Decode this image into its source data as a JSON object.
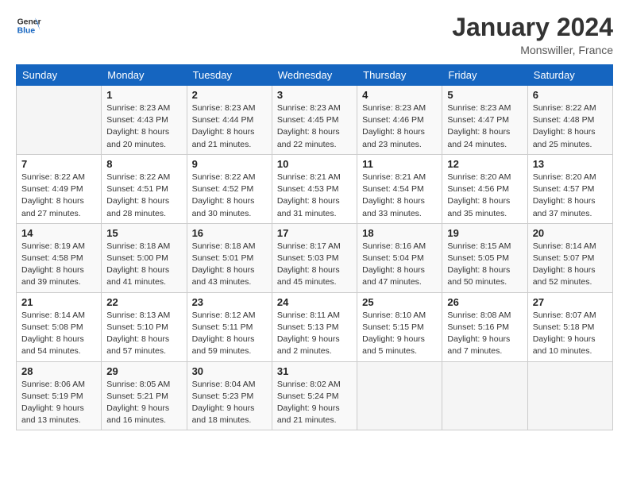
{
  "header": {
    "title": "January 2024",
    "location": "Monswiller, France"
  },
  "columns": [
    "Sunday",
    "Monday",
    "Tuesday",
    "Wednesday",
    "Thursday",
    "Friday",
    "Saturday"
  ],
  "weeks": [
    [
      {
        "day": "",
        "sunrise": "",
        "sunset": "",
        "daylight": ""
      },
      {
        "day": "1",
        "sunrise": "Sunrise: 8:23 AM",
        "sunset": "Sunset: 4:43 PM",
        "daylight": "Daylight: 8 hours and 20 minutes."
      },
      {
        "day": "2",
        "sunrise": "Sunrise: 8:23 AM",
        "sunset": "Sunset: 4:44 PM",
        "daylight": "Daylight: 8 hours and 21 minutes."
      },
      {
        "day": "3",
        "sunrise": "Sunrise: 8:23 AM",
        "sunset": "Sunset: 4:45 PM",
        "daylight": "Daylight: 8 hours and 22 minutes."
      },
      {
        "day": "4",
        "sunrise": "Sunrise: 8:23 AM",
        "sunset": "Sunset: 4:46 PM",
        "daylight": "Daylight: 8 hours and 23 minutes."
      },
      {
        "day": "5",
        "sunrise": "Sunrise: 8:23 AM",
        "sunset": "Sunset: 4:47 PM",
        "daylight": "Daylight: 8 hours and 24 minutes."
      },
      {
        "day": "6",
        "sunrise": "Sunrise: 8:22 AM",
        "sunset": "Sunset: 4:48 PM",
        "daylight": "Daylight: 8 hours and 25 minutes."
      }
    ],
    [
      {
        "day": "7",
        "sunrise": "Sunrise: 8:22 AM",
        "sunset": "Sunset: 4:49 PM",
        "daylight": "Daylight: 8 hours and 27 minutes."
      },
      {
        "day": "8",
        "sunrise": "Sunrise: 8:22 AM",
        "sunset": "Sunset: 4:51 PM",
        "daylight": "Daylight: 8 hours and 28 minutes."
      },
      {
        "day": "9",
        "sunrise": "Sunrise: 8:22 AM",
        "sunset": "Sunset: 4:52 PM",
        "daylight": "Daylight: 8 hours and 30 minutes."
      },
      {
        "day": "10",
        "sunrise": "Sunrise: 8:21 AM",
        "sunset": "Sunset: 4:53 PM",
        "daylight": "Daylight: 8 hours and 31 minutes."
      },
      {
        "day": "11",
        "sunrise": "Sunrise: 8:21 AM",
        "sunset": "Sunset: 4:54 PM",
        "daylight": "Daylight: 8 hours and 33 minutes."
      },
      {
        "day": "12",
        "sunrise": "Sunrise: 8:20 AM",
        "sunset": "Sunset: 4:56 PM",
        "daylight": "Daylight: 8 hours and 35 minutes."
      },
      {
        "day": "13",
        "sunrise": "Sunrise: 8:20 AM",
        "sunset": "Sunset: 4:57 PM",
        "daylight": "Daylight: 8 hours and 37 minutes."
      }
    ],
    [
      {
        "day": "14",
        "sunrise": "Sunrise: 8:19 AM",
        "sunset": "Sunset: 4:58 PM",
        "daylight": "Daylight: 8 hours and 39 minutes."
      },
      {
        "day": "15",
        "sunrise": "Sunrise: 8:18 AM",
        "sunset": "Sunset: 5:00 PM",
        "daylight": "Daylight: 8 hours and 41 minutes."
      },
      {
        "day": "16",
        "sunrise": "Sunrise: 8:18 AM",
        "sunset": "Sunset: 5:01 PM",
        "daylight": "Daylight: 8 hours and 43 minutes."
      },
      {
        "day": "17",
        "sunrise": "Sunrise: 8:17 AM",
        "sunset": "Sunset: 5:03 PM",
        "daylight": "Daylight: 8 hours and 45 minutes."
      },
      {
        "day": "18",
        "sunrise": "Sunrise: 8:16 AM",
        "sunset": "Sunset: 5:04 PM",
        "daylight": "Daylight: 8 hours and 47 minutes."
      },
      {
        "day": "19",
        "sunrise": "Sunrise: 8:15 AM",
        "sunset": "Sunset: 5:05 PM",
        "daylight": "Daylight: 8 hours and 50 minutes."
      },
      {
        "day": "20",
        "sunrise": "Sunrise: 8:14 AM",
        "sunset": "Sunset: 5:07 PM",
        "daylight": "Daylight: 8 hours and 52 minutes."
      }
    ],
    [
      {
        "day": "21",
        "sunrise": "Sunrise: 8:14 AM",
        "sunset": "Sunset: 5:08 PM",
        "daylight": "Daylight: 8 hours and 54 minutes."
      },
      {
        "day": "22",
        "sunrise": "Sunrise: 8:13 AM",
        "sunset": "Sunset: 5:10 PM",
        "daylight": "Daylight: 8 hours and 57 minutes."
      },
      {
        "day": "23",
        "sunrise": "Sunrise: 8:12 AM",
        "sunset": "Sunset: 5:11 PM",
        "daylight": "Daylight: 8 hours and 59 minutes."
      },
      {
        "day": "24",
        "sunrise": "Sunrise: 8:11 AM",
        "sunset": "Sunset: 5:13 PM",
        "daylight": "Daylight: 9 hours and 2 minutes."
      },
      {
        "day": "25",
        "sunrise": "Sunrise: 8:10 AM",
        "sunset": "Sunset: 5:15 PM",
        "daylight": "Daylight: 9 hours and 5 minutes."
      },
      {
        "day": "26",
        "sunrise": "Sunrise: 8:08 AM",
        "sunset": "Sunset: 5:16 PM",
        "daylight": "Daylight: 9 hours and 7 minutes."
      },
      {
        "day": "27",
        "sunrise": "Sunrise: 8:07 AM",
        "sunset": "Sunset: 5:18 PM",
        "daylight": "Daylight: 9 hours and 10 minutes."
      }
    ],
    [
      {
        "day": "28",
        "sunrise": "Sunrise: 8:06 AM",
        "sunset": "Sunset: 5:19 PM",
        "daylight": "Daylight: 9 hours and 13 minutes."
      },
      {
        "day": "29",
        "sunrise": "Sunrise: 8:05 AM",
        "sunset": "Sunset: 5:21 PM",
        "daylight": "Daylight: 9 hours and 16 minutes."
      },
      {
        "day": "30",
        "sunrise": "Sunrise: 8:04 AM",
        "sunset": "Sunset: 5:23 PM",
        "daylight": "Daylight: 9 hours and 18 minutes."
      },
      {
        "day": "31",
        "sunrise": "Sunrise: 8:02 AM",
        "sunset": "Sunset: 5:24 PM",
        "daylight": "Daylight: 9 hours and 21 minutes."
      },
      {
        "day": "",
        "sunrise": "",
        "sunset": "",
        "daylight": ""
      },
      {
        "day": "",
        "sunrise": "",
        "sunset": "",
        "daylight": ""
      },
      {
        "day": "",
        "sunrise": "",
        "sunset": "",
        "daylight": ""
      }
    ]
  ]
}
